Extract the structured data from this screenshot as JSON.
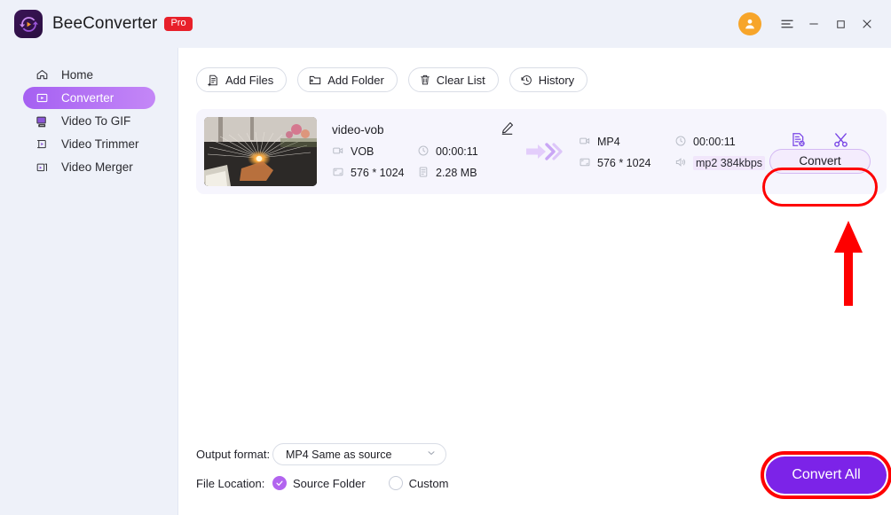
{
  "window": {
    "app_title": "BeeConverter",
    "pro_badge": "Pro",
    "controls": {
      "avatar": "user-avatar",
      "menu": "hamburger-menu",
      "minimize": "minimize",
      "maximize": "maximize",
      "close": "close"
    }
  },
  "sidebar": {
    "items": [
      {
        "label": "Home",
        "icon": "home-icon",
        "active": false
      },
      {
        "label": "Converter",
        "icon": "converter-icon",
        "active": true
      },
      {
        "label": "Video To GIF",
        "icon": "video-to-gif-icon",
        "active": false
      },
      {
        "label": "Video Trimmer",
        "icon": "video-trimmer-icon",
        "active": false
      },
      {
        "label": "Video Merger",
        "icon": "video-merger-icon",
        "active": false
      }
    ]
  },
  "toolbar": {
    "add_files": "Add Files",
    "add_folder": "Add Folder",
    "clear_list": "Clear List",
    "history": "History"
  },
  "file_item": {
    "name": "video-vob",
    "source": {
      "format": "VOB",
      "duration": "00:00:11",
      "resolution": "576 * 1024",
      "size": "2.28 MB"
    },
    "output": {
      "format": "MP4",
      "duration": "00:00:11",
      "resolution": "576 * 1024",
      "audio": "mp2 384kbps"
    },
    "convert_label": "Convert",
    "edit_icon": "pencil-edit-icon",
    "settings_icon": "output-settings-icon",
    "trim_icon": "scissors-trim-icon"
  },
  "footer": {
    "output_format_label": "Output format:",
    "output_format_value": "MP4 Same as source",
    "file_location_label": "File Location:",
    "location_source": "Source Folder",
    "location_custom": "Custom",
    "convert_all": "Convert All"
  },
  "annotation": {
    "arrow": "red-arrow-pointing-to-convert",
    "highlight_color": "#fe0000"
  },
  "colors": {
    "accent": "#7c23e8",
    "sidebar_bg": "#eef1f9",
    "active_nav": "#a560f2",
    "pro_badge": "#e8202a",
    "avatar": "#f7a52a",
    "card_bg": "#f6f5fd"
  }
}
